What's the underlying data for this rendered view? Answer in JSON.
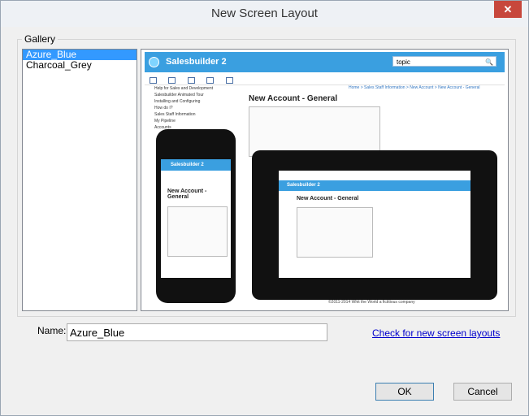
{
  "window": {
    "title": "New Screen Layout",
    "close_label": "✕"
  },
  "gallery": {
    "label": "Gallery",
    "items": [
      {
        "label": "Azure_Blue",
        "selected": true
      },
      {
        "label": "Charcoal_Grey",
        "selected": false
      }
    ]
  },
  "preview": {
    "app_name": "Salesbuilder 2",
    "search_value": "topic",
    "nav_items": [
      "Help for Sales and Development",
      "Salesbuilder Animated Tour",
      "Installing and Configuring",
      "How do I?",
      "Sales Staff Information",
      "My Pipeline",
      "Accounts"
    ],
    "breadcrumb": "Home > Sales Staff Information > New Account > New Account - General",
    "page_heading": "New Account - General",
    "footer": "©2011-2014 Whit the World    a fictitious company"
  },
  "form": {
    "name_label": "Name:",
    "name_value": "Azure_Blue",
    "check_link": "Check for new screen layouts"
  },
  "buttons": {
    "ok": "OK",
    "cancel": "Cancel"
  }
}
